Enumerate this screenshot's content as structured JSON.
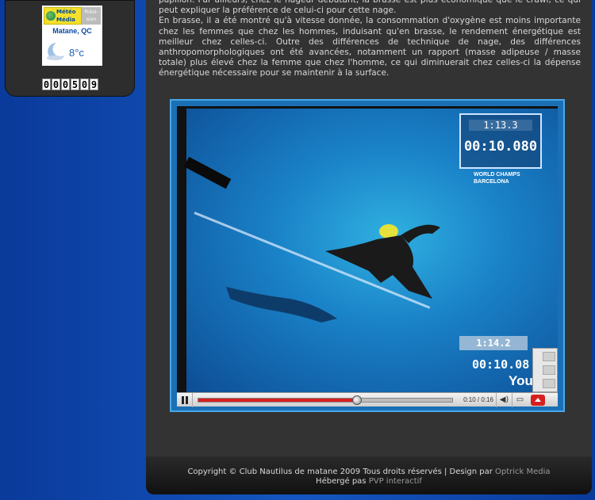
{
  "weather": {
    "brand_line1": "Météo",
    "brand_line2": "Média",
    "prevision_label": "Prévi-sion",
    "city": "Matane, QC",
    "temperature": "8°c"
  },
  "counter": {
    "digits": [
      "0",
      "0",
      "0",
      "5",
      "0",
      "9"
    ]
  },
  "article": {
    "paragraph_1": "papillon. Par ailleurs, chez le nageur débutant, la brasse est plus économique que le crawl, ce qui peut expliquer la préférence de celui-ci pour cette nage.",
    "paragraph_2": "En brasse, il a été montré qu'à vitesse donnée, la consommation d'oxygène est moins importante chez les femmes que chez les hommes, induisant qu'en brasse, le rendement énergétique est meilleur chez celles-ci. Outre des différences de technique de nage, des différences anthropomorphologiques ont été avancées, notamment un rapport (masse adipeuse / masse totale) plus élevé chez la femme que chez l'homme, ce qui diminuerait chez celles-ci la dépense énergétique nécessaire pour se maintenir à la surface."
  },
  "video": {
    "overlay_timer_small": "1:13.3",
    "overlay_timer_big": "00:10.080",
    "overlay_label_1": "WORLD CHAMPS",
    "overlay_label_2": "BARCELONA",
    "overlay_timer_bottom": "1:14.2",
    "overlay_timer_bottom_big": "00:10.08",
    "watermark": "You",
    "progress_fraction": 0.625,
    "time_display": "0:10 / 0:16"
  },
  "footer": {
    "copyright_text": "Copyright © Club Nautilus de matane 2009 Tous droits réservés | Design par",
    "designer_link": "Optrick Media",
    "hosted_text": "Hébergé pas",
    "host_link": "PVP interactif"
  }
}
